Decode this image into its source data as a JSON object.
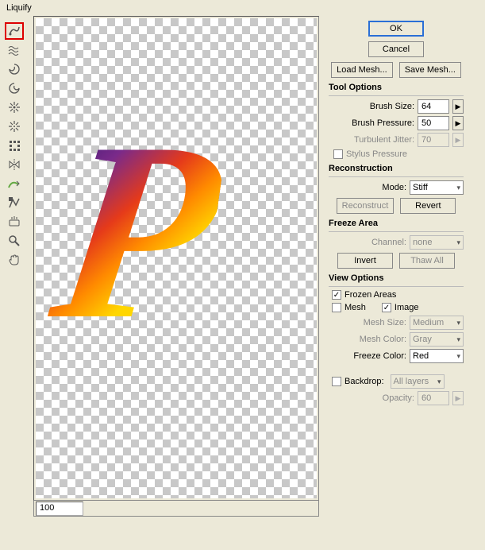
{
  "title": "Liquify",
  "zoom": "100",
  "buttons": {
    "ok": "OK",
    "cancel": "Cancel",
    "loadMesh": "Load Mesh...",
    "saveMesh": "Save Mesh...",
    "reconstruct": "Reconstruct",
    "revert": "Revert",
    "invert": "Invert",
    "thawAll": "Thaw All"
  },
  "sections": {
    "toolOptions": "Tool Options",
    "reconstruction": "Reconstruction",
    "freezeArea": "Freeze Area",
    "viewOptions": "View Options"
  },
  "labels": {
    "brushSize": "Brush Size:",
    "brushPressure": "Brush Pressure:",
    "turbulentJitter": "Turbulent Jitter:",
    "stylusPressure": "Stylus Pressure",
    "mode": "Mode:",
    "channel": "Channel:",
    "frozenAreas": "Frozen Areas",
    "mesh": "Mesh",
    "image": "Image",
    "meshSize": "Mesh Size:",
    "meshColor": "Mesh Color:",
    "freezeColor": "Freeze Color:",
    "backdrop": "Backdrop:",
    "opacity": "Opacity:"
  },
  "values": {
    "brushSize": "64",
    "brushPressure": "50",
    "turbulentJitter": "70",
    "mode": "Stiff",
    "channel": "none",
    "meshSize": "Medium",
    "meshColor": "Gray",
    "freezeColor": "Red",
    "backdrop": "All layers",
    "opacity": "60"
  },
  "checks": {
    "stylusPressure": false,
    "frozenAreas": true,
    "mesh": false,
    "image": true,
    "backdrop": false
  }
}
